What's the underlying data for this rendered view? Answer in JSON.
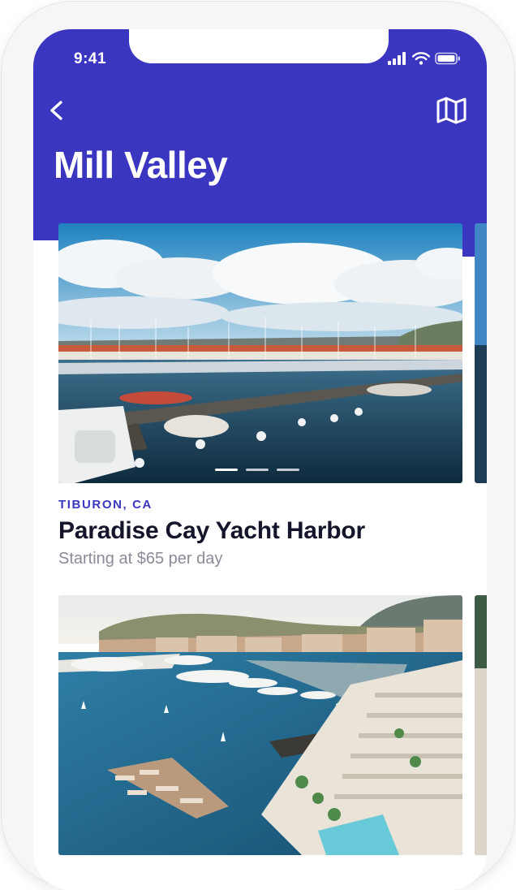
{
  "status_bar": {
    "time": "9:41",
    "icons": [
      "signal-icon",
      "wifi-icon",
      "battery-icon"
    ]
  },
  "header": {
    "back_icon": "chevron-left-icon",
    "map_icon": "map-icon",
    "title": "Mill Valley"
  },
  "listings": [
    {
      "location": "TIBURON, CA",
      "title": "Paradise Cay Yacht Harbor",
      "price": "Starting at $65 per day",
      "photo_count": 3,
      "active_photo": 1
    },
    {
      "location": "",
      "title": "",
      "price": ""
    }
  ],
  "colors": {
    "brand": "#3A36C0",
    "text_dark": "#14142B",
    "text_muted": "#8A8A99",
    "background": "#FFFFFF"
  }
}
